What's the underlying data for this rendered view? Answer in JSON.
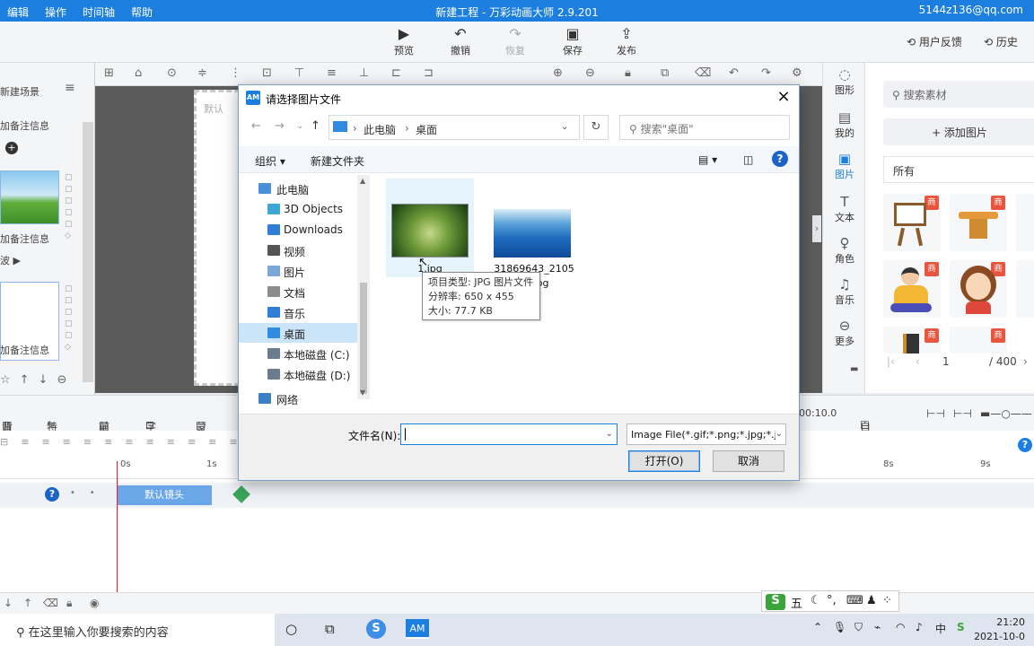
{
  "app": {
    "menu": [
      "编辑",
      "操作",
      "时间轴",
      "帮助"
    ],
    "title": "新建工程 - 万彩动画大师 2.9.201",
    "account": "5144z136@qq.com"
  },
  "toolbar": {
    "preview": "预览",
    "undo": "撤销",
    "redo": "恢复",
    "save": "保存",
    "publish": "发布",
    "feedback": "用户反馈",
    "history": "历史"
  },
  "scenes": {
    "new_scene": "新建场景",
    "note": "加备注信息",
    "scene_label_2": "波"
  },
  "canvas": {
    "stage_label": "默认"
  },
  "right_panel": {
    "items": [
      "图形",
      "我的",
      "图片",
      "文本",
      "角色",
      "音乐",
      "更多"
    ],
    "search_placeholder": "搜索素材",
    "add_image": "+ 添加图片",
    "category": "所有",
    "badge": "商",
    "page": "1",
    "total": "/ 400"
  },
  "layer_bar": {
    "background": "背景",
    "effects": "特效",
    "foreground": "前景",
    "subtitle": "字幕",
    "border": "蒙版",
    "time": "00:10.0",
    "auto_fit": "自动适应"
  },
  "timeline": {
    "ticks": [
      "0s",
      "1s",
      "8s",
      "9s"
    ],
    "clip": "默认镜头"
  },
  "ime": {
    "label": "五"
  },
  "taskbar": {
    "search": "在这里输入你要搜索的内容",
    "time": "21:20",
    "date": "2021-10-0",
    "app_label": "AM"
  },
  "dialog": {
    "title": "请选择图片文件",
    "logo": "AM",
    "breadcrumb": [
      "此电脑",
      "桌面"
    ],
    "search_placeholder": "搜索\"桌面\"",
    "organize": "组织 ▾",
    "new_folder": "新建文件夹",
    "help": "?",
    "tree": [
      {
        "label": "此电脑",
        "color": "#4a90d9"
      },
      {
        "label": "3D Objects",
        "color": "#3fa7d6"
      },
      {
        "label": "Downloads",
        "color": "#2f7ed8"
      },
      {
        "label": "视频",
        "color": "#555555"
      },
      {
        "label": "图片",
        "color": "#7aa7d6"
      },
      {
        "label": "文档",
        "color": "#8c8c8c"
      },
      {
        "label": "音乐",
        "color": "#2f7ed8"
      },
      {
        "label": "桌面",
        "color": "#2f8ce0"
      },
      {
        "label": "本地磁盘 (C:)",
        "color": "#6b7c8f"
      },
      {
        "label": "本地磁盘 (D:)",
        "color": "#6b7c8f"
      },
      {
        "label": "网络",
        "color": "#3d7fc4"
      }
    ],
    "files": [
      {
        "name": "1.jpg"
      },
      {
        "name": "31869643_2105",
        "name2": "_2.jpg"
      }
    ],
    "tooltip": {
      "type": "项目类型: JPG 图片文件",
      "resolution": "分辨率: 650 x 455",
      "size": "大小: 77.7 KB"
    },
    "filename_label": "文件名(N):",
    "filename_value": "",
    "filter": "Image File(*.gif;*.png;*.jpg;*.j",
    "open": "打开(O)",
    "cancel": "取消"
  }
}
